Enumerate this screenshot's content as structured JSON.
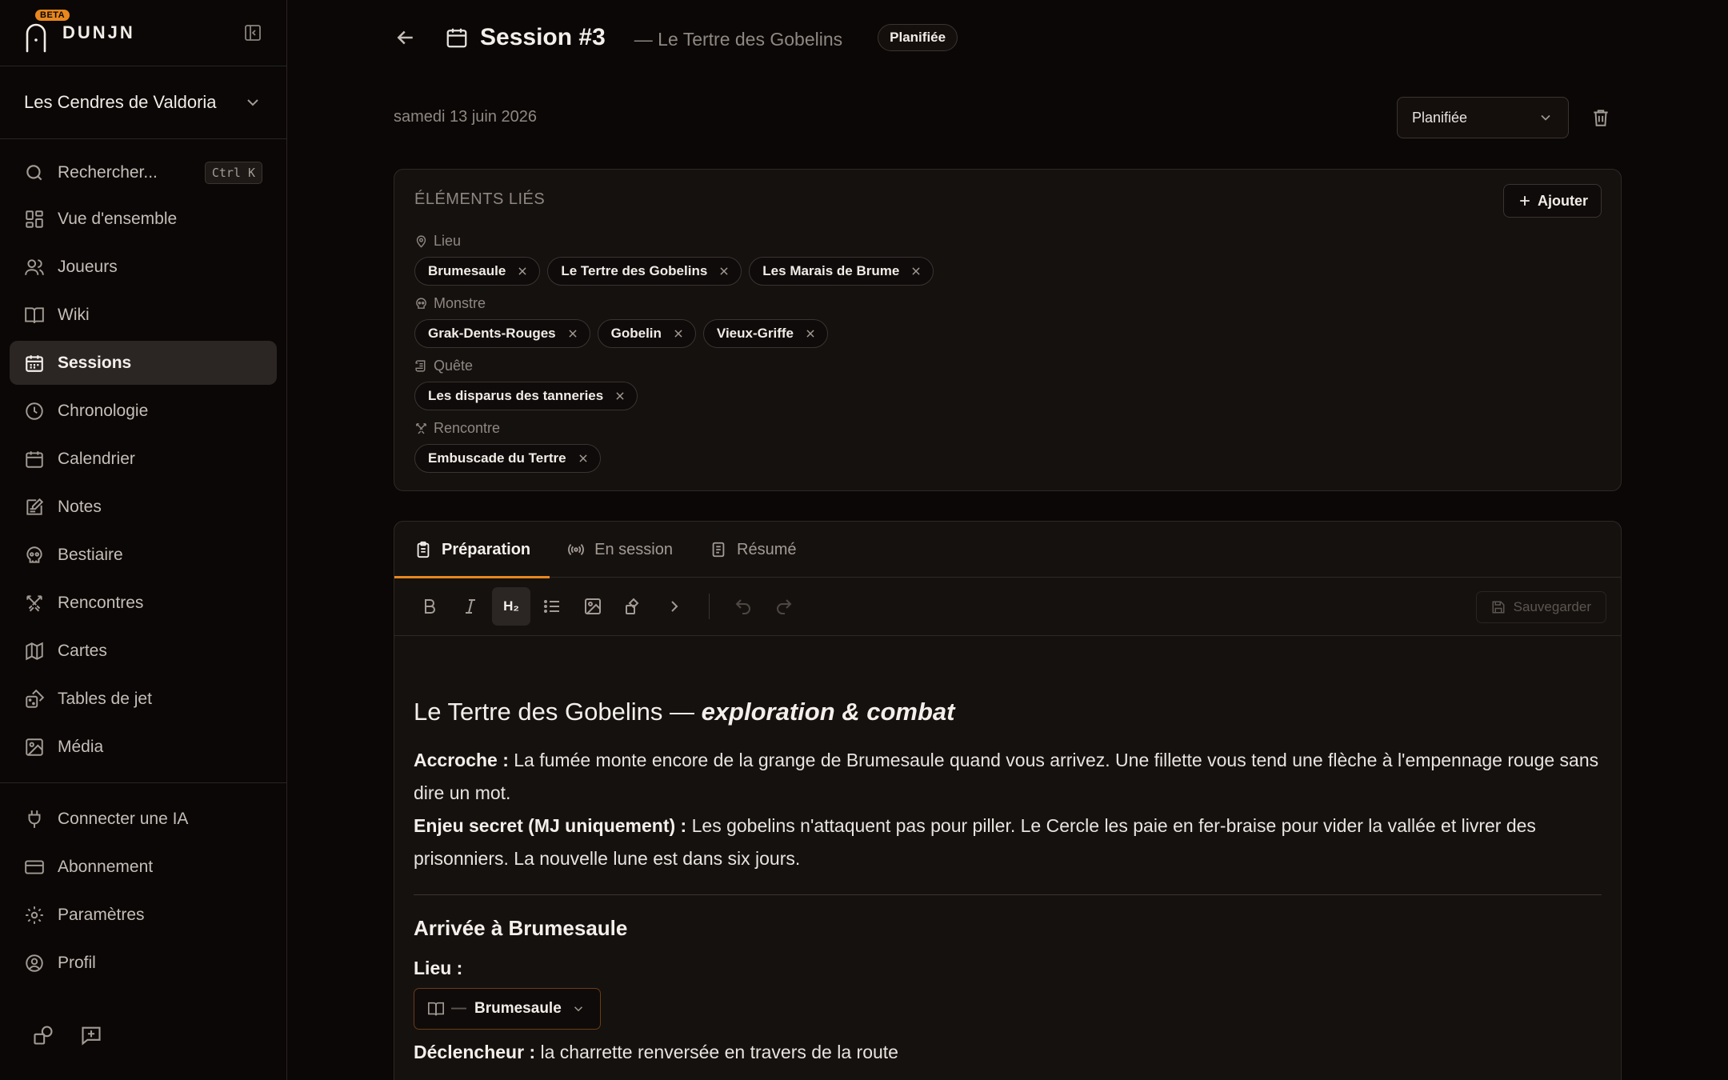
{
  "app": {
    "name": "DUNJN",
    "beta": "BETA"
  },
  "campaign": {
    "name": "Les Cendres de Valdoria"
  },
  "search": {
    "label": "Rechercher...",
    "shortcut": "Ctrl K"
  },
  "nav": {
    "items": [
      {
        "label": "Vue d'ensemble",
        "icon": "dashboard-icon"
      },
      {
        "label": "Joueurs",
        "icon": "users-icon"
      },
      {
        "label": "Wiki",
        "icon": "book-icon"
      },
      {
        "label": "Sessions",
        "icon": "calendar-icon",
        "active": true
      },
      {
        "label": "Chronologie",
        "icon": "clock-icon"
      },
      {
        "label": "Calendrier",
        "icon": "calendar-icon"
      },
      {
        "label": "Notes",
        "icon": "note-icon"
      },
      {
        "label": "Bestiaire",
        "icon": "skull-icon"
      },
      {
        "label": "Rencontres",
        "icon": "swords-icon"
      },
      {
        "label": "Cartes",
        "icon": "map-icon"
      },
      {
        "label": "Tables de jet",
        "icon": "dice-icon"
      },
      {
        "label": "Média",
        "icon": "image-icon"
      }
    ],
    "bottom": [
      {
        "label": "Connecter une IA",
        "icon": "plug-icon"
      },
      {
        "label": "Abonnement",
        "icon": "credit-card-icon"
      },
      {
        "label": "Paramètres",
        "icon": "gear-icon"
      },
      {
        "label": "Profil",
        "icon": "user-circle-icon"
      }
    ]
  },
  "session": {
    "title": "Session #3",
    "subtitle": "— Le Tertre des Gobelins",
    "badge": "Planifiée",
    "date": "samedi 13 juin 2026",
    "status": "Planifiée"
  },
  "linked": {
    "title": "ÉLÉMENTS LIÉS",
    "add_label": "Ajouter",
    "groups": [
      {
        "label": "Lieu",
        "icon": "map-pin-icon",
        "items": [
          "Brumesaule",
          "Le Tertre des Gobelins",
          "Les Marais de Brume"
        ]
      },
      {
        "label": "Monstre",
        "icon": "monster-icon",
        "items": [
          "Grak-Dents-Rouges",
          "Gobelin",
          "Vieux-Griffe"
        ]
      },
      {
        "label": "Quête",
        "icon": "scroll-icon",
        "items": [
          "Les disparus des tanneries"
        ]
      },
      {
        "label": "Rencontre",
        "icon": "swords-icon",
        "items": [
          "Embuscade du Tertre"
        ]
      }
    ]
  },
  "tabs": [
    {
      "label": "Préparation",
      "icon": "clipboard-icon",
      "active": true
    },
    {
      "label": "En session",
      "icon": "broadcast-icon"
    },
    {
      "label": "Résumé",
      "icon": "document-icon"
    }
  ],
  "toolbar": {
    "h2_label": "H₂",
    "save_label": "Sauvegarder"
  },
  "doc": {
    "heading_main": "Le Tertre des Gobelins — ",
    "heading_em": "exploration & combat",
    "hook_label": "Accroche :",
    "hook_text": " La fumée monte encore de la grange de Brumesaule quand vous arrivez. Une fillette vous tend une flèche à l'empennage rouge sans dire un mot.",
    "secret_label": "Enjeu secret (MJ uniquement) :",
    "secret_text": " Les gobelins n'attaquent pas pour piller. Le Cercle les paie en fer-braise pour vider la vallée et livrer des prisonniers. La nouvelle lune est dans six jours.",
    "section_title": "Arrivée à Brumesaule",
    "place_label": "Lieu :",
    "place_entity_dash": "—",
    "place_entity": "Brumesaule",
    "trigger_label": "Déclencheur :",
    "trigger_text": " la charrette renversée en travers de la route"
  }
}
